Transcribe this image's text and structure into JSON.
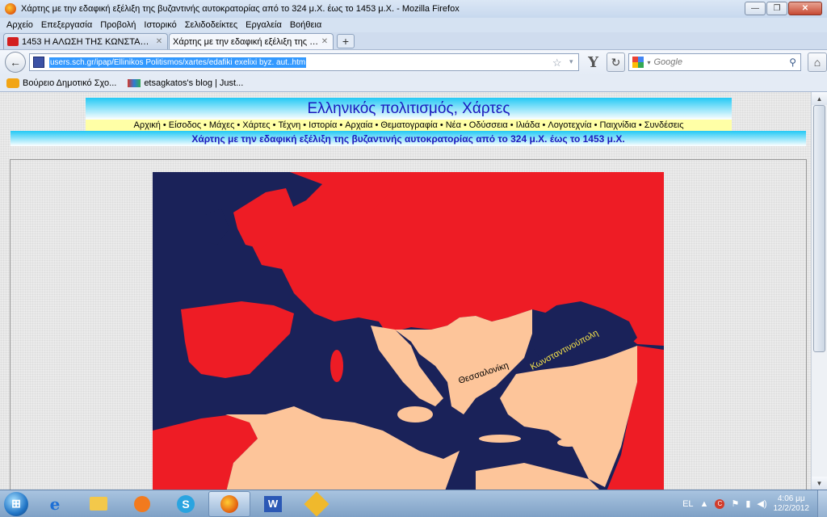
{
  "window": {
    "title": "Χάρτης με την εδαφική εξέλιξη της βυζαντινής αυτοκρατορίας από το 324 μ.Χ. έως το 1453 μ.Χ. - Mozilla Firefox",
    "minimize": "—",
    "maximize": "❐",
    "close": "✕"
  },
  "menu": [
    "Αρχείο",
    "Επεξεργασία",
    "Προβολή",
    "Ιστορικό",
    "Σελιδοδείκτες",
    "Εργαλεία",
    "Βοήθεια"
  ],
  "tabs": [
    {
      "label": "1453 Η ΑΛΩΣΗ ΤΗΣ ΚΩΝΣΤΑΝΤΙΝΟΥ...",
      "icon": "youtube-icon"
    },
    {
      "label": "Χάρτης με την εδαφική εξέλιξη της β...",
      "icon": "page-icon"
    }
  ],
  "newtab": "+",
  "nav": {
    "back": "←",
    "url": "users.sch.gr/ipap/Ellinikos Politismos/xartes/edafiki exelixi byz. aut..htm",
    "star": "☆",
    "dropdown": "▾",
    "y_button": "Y",
    "reload": "↻",
    "search_placeholder": "Google",
    "search_icon": "⚲",
    "home": "⌂"
  },
  "bookmarks": [
    "Βούρειο Δημοτικό Σχο...",
    "etsagkatos's blog | Just..."
  ],
  "page": {
    "site_title": "Ελληνικός πολιτισμός, Χάρτες",
    "nav_links": [
      "Αρχική",
      "Είσοδος",
      "Μάχες",
      "Χάρτες",
      "Τέχνη",
      "Ιστορία",
      "Αρχαία",
      "Θεματογραφία",
      "Νέα",
      "Οδύσσεια",
      "Ιλιάδα",
      "Λογοτεχνία",
      "Παιχνίδια",
      "Συνδέσεις"
    ],
    "separator": "•",
    "subtitle": "Χάρτης με την εδαφική εξέλιξη της βυζαντινής αυτοκρατορίας από το 324 μ.Χ. έως το 1453 μ.Χ.",
    "map_labels": {
      "thessaloniki": "Θεσσαλονίκη",
      "constantinople": "Κωνσταντινούπολη"
    },
    "map_colors": {
      "sea": "#1a2259",
      "foreign_land": "#ee1c25",
      "byzantine_land": "#fdc59a"
    }
  },
  "scrollbar": {
    "up": "▲",
    "down": "▼"
  },
  "taskbar": {
    "start": "⊞",
    "apps": [
      "e",
      "",
      "",
      "S",
      "",
      "W",
      ""
    ],
    "lang": "EL",
    "tray_arrow": "▲",
    "tray_red": "C",
    "time": "4:06 μμ",
    "date": "12/2/2012"
  }
}
